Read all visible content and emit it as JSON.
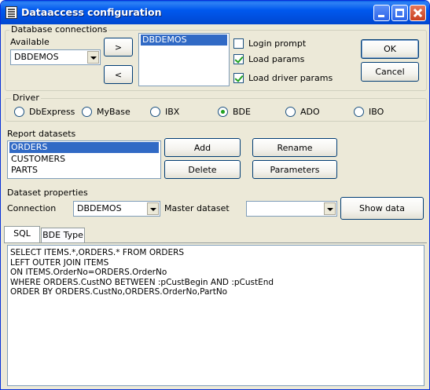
{
  "window": {
    "title": "Dataaccess configuration"
  },
  "db_connections": {
    "caption": "Database connections",
    "available_label": "Available",
    "available_value": "DBDEMOS",
    "add_button": ">",
    "remove_button": "<",
    "selected_items": [
      "DBDEMOS"
    ],
    "options": [
      {
        "label": "Login prompt",
        "checked": false
      },
      {
        "label": "Load params",
        "checked": true
      },
      {
        "label": "Load driver params",
        "checked": true
      }
    ],
    "ok_button": "OK",
    "cancel_button": "Cancel"
  },
  "driver": {
    "caption": "Driver",
    "options": [
      {
        "label": "DbExpress",
        "selected": false
      },
      {
        "label": "MyBase",
        "selected": false
      },
      {
        "label": "IBX",
        "selected": false
      },
      {
        "label": "BDE",
        "selected": true
      },
      {
        "label": "ADO",
        "selected": false
      },
      {
        "label": "IBO",
        "selected": false
      }
    ]
  },
  "report_datasets": {
    "label": "Report datasets",
    "items": [
      {
        "label": "ORDERS",
        "selected": true
      },
      {
        "label": "CUSTOMERS",
        "selected": false
      },
      {
        "label": "PARTS",
        "selected": false
      }
    ],
    "add_button": "Add",
    "delete_button": "Delete",
    "rename_button": "Rename",
    "parameters_button": "Parameters"
  },
  "dataset_properties": {
    "label": "Dataset properties",
    "connection_label": "Connection",
    "connection_value": "DBDEMOS",
    "master_label": "Master dataset",
    "master_value": "",
    "show_data_button": "Show data"
  },
  "tabs": [
    {
      "label": "SQL",
      "active": true
    },
    {
      "label": "BDE Type",
      "active": false
    }
  ],
  "sql_text": "SELECT ITEMS.*,ORDERS.* FROM ORDERS\nLEFT OUTER JOIN ITEMS\nON ITEMS.OrderNo=ORDERS.OrderNo\nWHERE ORDERS.CustNO BETWEEN :pCustBegin AND :pCustEnd\nORDER BY ORDERS.CustNo,ORDERS.OrderNo,PartNo"
}
